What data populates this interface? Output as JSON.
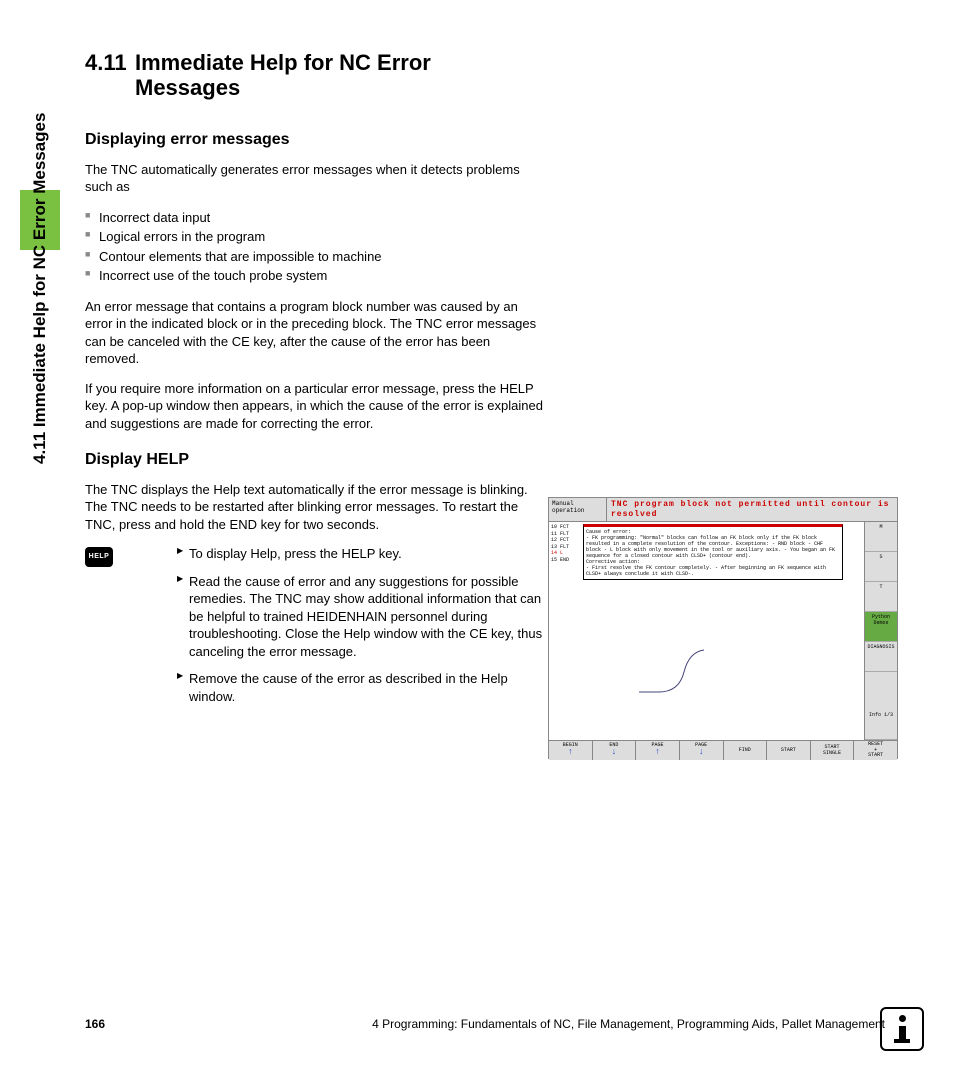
{
  "sideTab": "4.11 Immediate Help for NC Error Messages",
  "heading": {
    "number": "4.11",
    "title": "Immediate Help for NC Error Messages"
  },
  "section1": {
    "title": "Displaying error messages",
    "intro": "The TNC automatically generates error messages when it detects problems such as",
    "bullets": [
      "Incorrect data input",
      "Logical errors in the program",
      "Contour elements that are impossible to machine",
      "Incorrect use of the touch probe system"
    ],
    "p2": "An error message that contains a program block number was caused by an error in the indicated block or in the preceding block. The TNC error messages can be canceled with the CE key, after the cause of the error has been removed.",
    "p3": "If you require more information on a particular error message, press the HELP key. A pop-up window then appears, in which the cause of the error is explained and suggestions are made for correcting the error."
  },
  "section2": {
    "title": "Display HELP",
    "intro": "The TNC displays the Help text automatically if the error message is blinking. The TNC needs to be restarted after blinking error messages. To restart the TNC, press and hold the END key for two seconds.",
    "keyLabel": "HELP",
    "steps": [
      "To display Help, press the HELP key.",
      "Read the cause of error and any suggestions for possible remedies. The TNC may show additional information that can be helpful to trained HEIDENHAIN personnel during troubleshooting. Close the Help window with the CE key, thus canceling the error message.",
      "Remove the cause of the error as described in the Help window."
    ]
  },
  "screenshot": {
    "mode": "Manual operation",
    "errorTitle": "TNC program block not permitted until contour is resolved",
    "codeLines": [
      "10 FCT",
      "11 FLT",
      "12 FCT",
      "13 FLT",
      "14 L",
      "15 END"
    ],
    "popup": {
      "causeLabel": "Cause of error:",
      "causeText": "- FK programming: \"Normal\" blocks can follow an FK block only if the FK block resulted in a complete resolution of the contour. Exceptions:\n- RND block\n- CHF block\n- L block with only movement in the tool or auxiliary axis.\n- You began an FK sequence for a closed contour with CLSD+ (contour end).",
      "actionLabel": "Corrective action:",
      "actionText": "- First resolve the FK contour completely.\n- After beginning an FK sequence with CLSD+ always conclude it with CLSD-."
    },
    "sidebar": [
      "M",
      "S",
      "T",
      "Python Demos",
      "DIAGNOSIS",
      "Info 1/3"
    ],
    "softkeys": [
      {
        "l1": "BEGIN",
        "arrow": "up"
      },
      {
        "l1": "END",
        "arrow": "down"
      },
      {
        "l1": "PAGE",
        "arrow": "up"
      },
      {
        "l1": "PAGE",
        "arrow": "down"
      },
      {
        "l1": "FIND"
      },
      {
        "l1": "START"
      },
      {
        "l1": "START",
        "l2": "SINGLE"
      },
      {
        "l1": "RESET",
        "l2": "+",
        "l3": "START"
      }
    ]
  },
  "footer": {
    "page": "166",
    "chapter": "4 Programming: Fundamentals of NC, File Management, Programming Aids, Pallet Management"
  }
}
